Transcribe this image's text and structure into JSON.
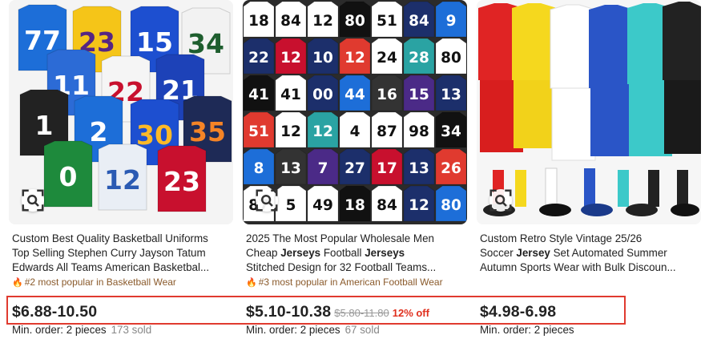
{
  "products": [
    {
      "image_icon": "basketball-jerseys-image",
      "search_icon": "image-search-icon",
      "title_lines": [
        [
          {
            "t": "Custom Best Quality Basketball Uniforms"
          }
        ],
        [
          {
            "t": "Top Selling Stephen Curry Jayson Tatum"
          }
        ],
        [
          {
            "t": "Edwards All Teams American Basketbal..."
          }
        ]
      ],
      "rank": "#2 most popular in Basketball Wear",
      "price": "$6.88-10.50",
      "old_price": "",
      "discount": "",
      "moq": "Min. order: 2 pieces",
      "sold": "173 sold"
    },
    {
      "image_icon": "football-jerseys-image",
      "search_icon": "image-search-icon",
      "title_lines": [
        [
          {
            "t": "2025 The Most Popular Wholesale Men"
          }
        ],
        [
          {
            "t": "Cheap "
          },
          {
            "t": "Jerseys",
            "b": true
          },
          {
            "t": " Football "
          },
          {
            "t": "Jerseys",
            "b": true
          }
        ],
        [
          {
            "t": "Stitched Design for 32 Football Teams..."
          }
        ]
      ],
      "rank": "#3 most popular in American Football Wear",
      "price": "$5.10-10.38",
      "old_price": "$5.80-11.80",
      "discount": "12% off",
      "moq": "Min. order: 2 pieces",
      "sold": "67 sold"
    },
    {
      "image_icon": "soccer-set-image",
      "search_icon": "image-search-icon",
      "title_lines": [
        [
          {
            "t": "Custom Retro Style Vintage 25/26"
          }
        ],
        [
          {
            "t": "Soccer "
          },
          {
            "t": "Jersey",
            "b": true
          },
          {
            "t": " Set Automated Summer"
          }
        ],
        [
          {
            "t": "Autumn Sports Wear with Bulk Discoun..."
          }
        ]
      ],
      "rank": "",
      "price": "$4.98-6.98",
      "old_price": "",
      "discount": "",
      "moq": "Min. order: 2 pieces",
      "sold": ""
    }
  ],
  "jersey_numbers": {
    "basketball": [
      "77",
      "23",
      "15",
      "34",
      "11",
      "22",
      "21",
      "1",
      "2",
      "30",
      "35",
      "0",
      "12",
      "23"
    ],
    "football": [
      "18",
      "84",
      "12",
      "80",
      "51",
      "84",
      "9",
      "22",
      "12",
      "10",
      "12",
      "24",
      "28",
      "80",
      "41",
      "41",
      "00",
      "44",
      "16",
      "15",
      "13",
      "51",
      "12",
      "12",
      "4",
      "87",
      "98",
      "34",
      "8",
      "13",
      "7",
      "27",
      "17",
      "13",
      "26",
      "87",
      "5",
      "49"
    ],
    "soccer": []
  },
  "colors": {
    "highlight": "#e03a2f",
    "discount": "#e0301e",
    "rank": "#8a5a2b",
    "flame": "#e06c1f"
  }
}
